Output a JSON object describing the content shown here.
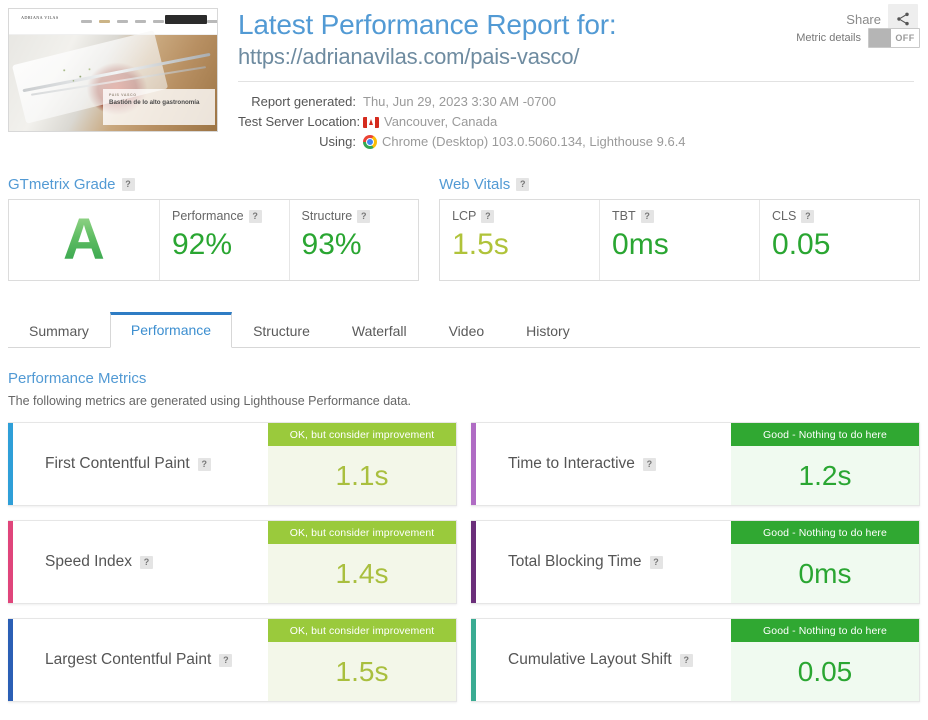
{
  "header": {
    "title": "Latest Performance Report for:",
    "url": "https://adrianavilas.com/pais-vasco/",
    "share_label": "Share",
    "share_icon": "share-icon",
    "thumbnail": {
      "site_logo": "ADRIANA VILAS",
      "hero_kicker": "PAIS VASCO",
      "hero_title": "Bastión de lo alto gastronomía"
    },
    "meta": [
      {
        "label": "Report generated:",
        "value": "Thu, Jun 29, 2023 3:30 AM -0700",
        "icon": ""
      },
      {
        "label": "Test Server Location:",
        "value": "Vancouver, Canada",
        "icon": "canada-flag-icon"
      },
      {
        "label": "Using:",
        "value": "Chrome (Desktop) 103.0.5060.134, Lighthouse 9.6.4",
        "icon": "chrome-icon"
      }
    ]
  },
  "gtmetrix_grade": {
    "heading": "GTmetrix Grade",
    "help": "?",
    "grade": "A",
    "cells": [
      {
        "label": "Performance",
        "value": "92%",
        "help": "?"
      },
      {
        "label": "Structure",
        "value": "93%",
        "help": "?"
      }
    ]
  },
  "web_vitals": {
    "heading": "Web Vitals",
    "help": "?",
    "cells": [
      {
        "label": "LCP",
        "value": "1.5s",
        "help": "?",
        "tone": "olive"
      },
      {
        "label": "TBT",
        "value": "0ms",
        "help": "?",
        "tone": "green"
      },
      {
        "label": "CLS",
        "value": "0.05",
        "help": "?",
        "tone": "green"
      }
    ]
  },
  "tabs": [
    {
      "label": "Summary",
      "active": false
    },
    {
      "label": "Performance",
      "active": true
    },
    {
      "label": "Structure",
      "active": false
    },
    {
      "label": "Waterfall",
      "active": false
    },
    {
      "label": "Video",
      "active": false
    },
    {
      "label": "History",
      "active": false
    }
  ],
  "metrics_section": {
    "title": "Performance Metrics",
    "subtitle": "The following metrics are generated using Lighthouse Performance data.",
    "toggle_label": "Metric details",
    "toggle_state": "OFF"
  },
  "metrics": [
    {
      "name": "First Contentful Paint",
      "help": "?",
      "banner": "OK, but consider improvement",
      "value": "1.1s",
      "tone": "ok",
      "accent": "#2f9fd8"
    },
    {
      "name": "Time to Interactive",
      "help": "?",
      "banner": "Good - Nothing to do here",
      "value": "1.2s",
      "tone": "good",
      "accent": "#b06cc4"
    },
    {
      "name": "Speed Index",
      "help": "?",
      "banner": "OK, but consider improvement",
      "value": "1.4s",
      "tone": "ok",
      "accent": "#e0457b"
    },
    {
      "name": "Total Blocking Time",
      "help": "?",
      "banner": "Good - Nothing to do here",
      "value": "0ms",
      "tone": "good",
      "accent": "#6b2f7a"
    },
    {
      "name": "Largest Contentful Paint",
      "help": "?",
      "banner": "OK, but consider improvement",
      "value": "1.5s",
      "tone": "ok",
      "accent": "#2b5fb5"
    },
    {
      "name": "Cumulative Layout Shift",
      "help": "?",
      "banner": "Good - Nothing to do here",
      "value": "0.05",
      "tone": "good",
      "accent": "#3aab92"
    }
  ],
  "colors": {
    "accent_blue": "#529ad4",
    "good_green": "#30a832",
    "ok_olive": "#9aca3c",
    "value_green": "#2aa632",
    "value_olive": "#a9bf3e"
  }
}
